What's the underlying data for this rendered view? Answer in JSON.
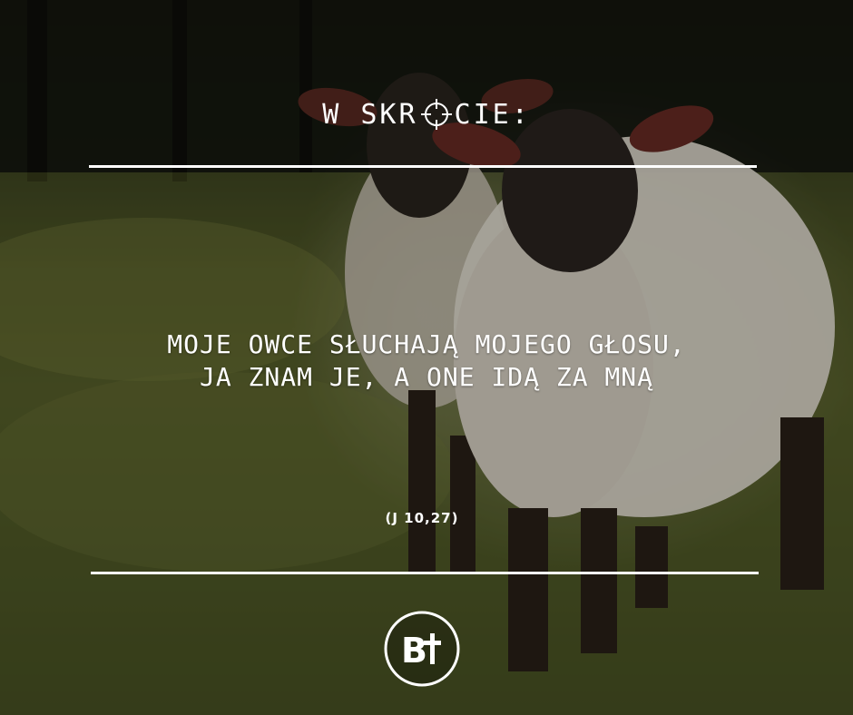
{
  "header": {
    "title_left": "W SKR",
    "title_right": "CIE:",
    "title_icon": "crosshair-icon"
  },
  "quote": {
    "line1": "MOJE OWCE SŁUCHAJĄ MOJEGO GŁOSU,",
    "line2": "JA ZNAM JE, A ONE IDĄ ZA MNĄ"
  },
  "reference": "(J 10,27)",
  "logo": {
    "letters": "B",
    "icon": "cross-icon"
  },
  "colors": {
    "text": "#ffffff",
    "grass": "#5c6430",
    "wool": "#e6e0d4"
  }
}
